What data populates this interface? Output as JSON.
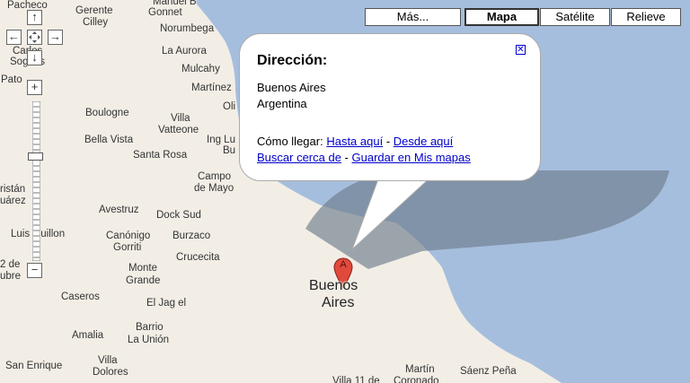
{
  "map_types": {
    "more": "Más...",
    "map": "Mapa",
    "satellite": "Satélite",
    "terrain": "Relieve",
    "selected": "Mapa"
  },
  "nav_controls": {
    "pan_up": "↑",
    "pan_left": "←",
    "pan_right": "→",
    "pan_down": "↓",
    "zoom_in": "+",
    "zoom_out": "−"
  },
  "info_window": {
    "title": "Dirección:",
    "address_line1": "Buenos Aires",
    "address_line2": "Argentina",
    "directions_prefix": "Cómo llegar:",
    "to_here": "Hasta aquí",
    "separator1": " - ",
    "from_here": "Desde aquí",
    "search_nearby": "Buscar cerca de",
    "separator2": " - ",
    "save_to_my_maps": "Guardar en Mis mapas",
    "close": "✕"
  },
  "marker": {
    "letter": "A",
    "color": "#e04a3c"
  },
  "map_labels": {
    "pacheco": "Pacheco",
    "gerente_cilley_1": "Gerente",
    "gerente_cilley_2": "Cilley",
    "manuel_b": "Manuel B",
    "gonnet": "Gonnet",
    "norumbega": "Norumbega",
    "la_aurora": "La Aurora",
    "carlos_1": "Carlos",
    "carlos_2": "Sogues",
    "mulcahy": "Mulcahy",
    "pato": "Pato",
    "martinez": "Martínez",
    "olivera": "Oli",
    "boulogne": "Boulogne",
    "villa_vatteone_1": "Villa",
    "villa_vatteone_2": "Vatteone",
    "bella_vista": "Bella Vista",
    "ing_luis_1": "Ing Lu",
    "ing_luis_2": "Bu",
    "santa_rosa": "Santa Rosa",
    "campo_de_mayo_1": "Campo",
    "campo_de_mayo_2": "de Mayo",
    "cristan": "ristán",
    "suarez": "uárez",
    "avestruz": "Avestruz",
    "dock_sud": "Dock Sud",
    "luis_guillon": "Luis Guillon",
    "canonigo_gorriti_1": "Canónigo",
    "canonigo_gorriti_2": "Gorriti",
    "burzaco": "Burzaco",
    "crucecita": "Crucecita",
    "de_lujan_1": "2 de",
    "de_lujan_2": "ubre",
    "monte_grande_1": "Monte",
    "monte_grande_2": "Grande",
    "caseros": "Caseros",
    "el_jag": "El Jag el",
    "barrio_la_union_1": "Barrio",
    "barrio_la_union_2": "La Unión",
    "amalia": "Amalia",
    "villa_dolores_1": "Villa",
    "villa_dolores_2": "Dolores",
    "san_enrique": "San Enrique",
    "martin_coronado_1": "Martín",
    "martin_coronado_2": "Coronado",
    "villa_11": "Villa 11 de",
    "saenz_pena": "Sáenz Peña",
    "buenos_aires_1": "Buenos",
    "buenos_aires_2": "Aires"
  },
  "colors": {
    "water": "#a6bedd",
    "land": "#f2eee6",
    "link": "#0000cc"
  }
}
